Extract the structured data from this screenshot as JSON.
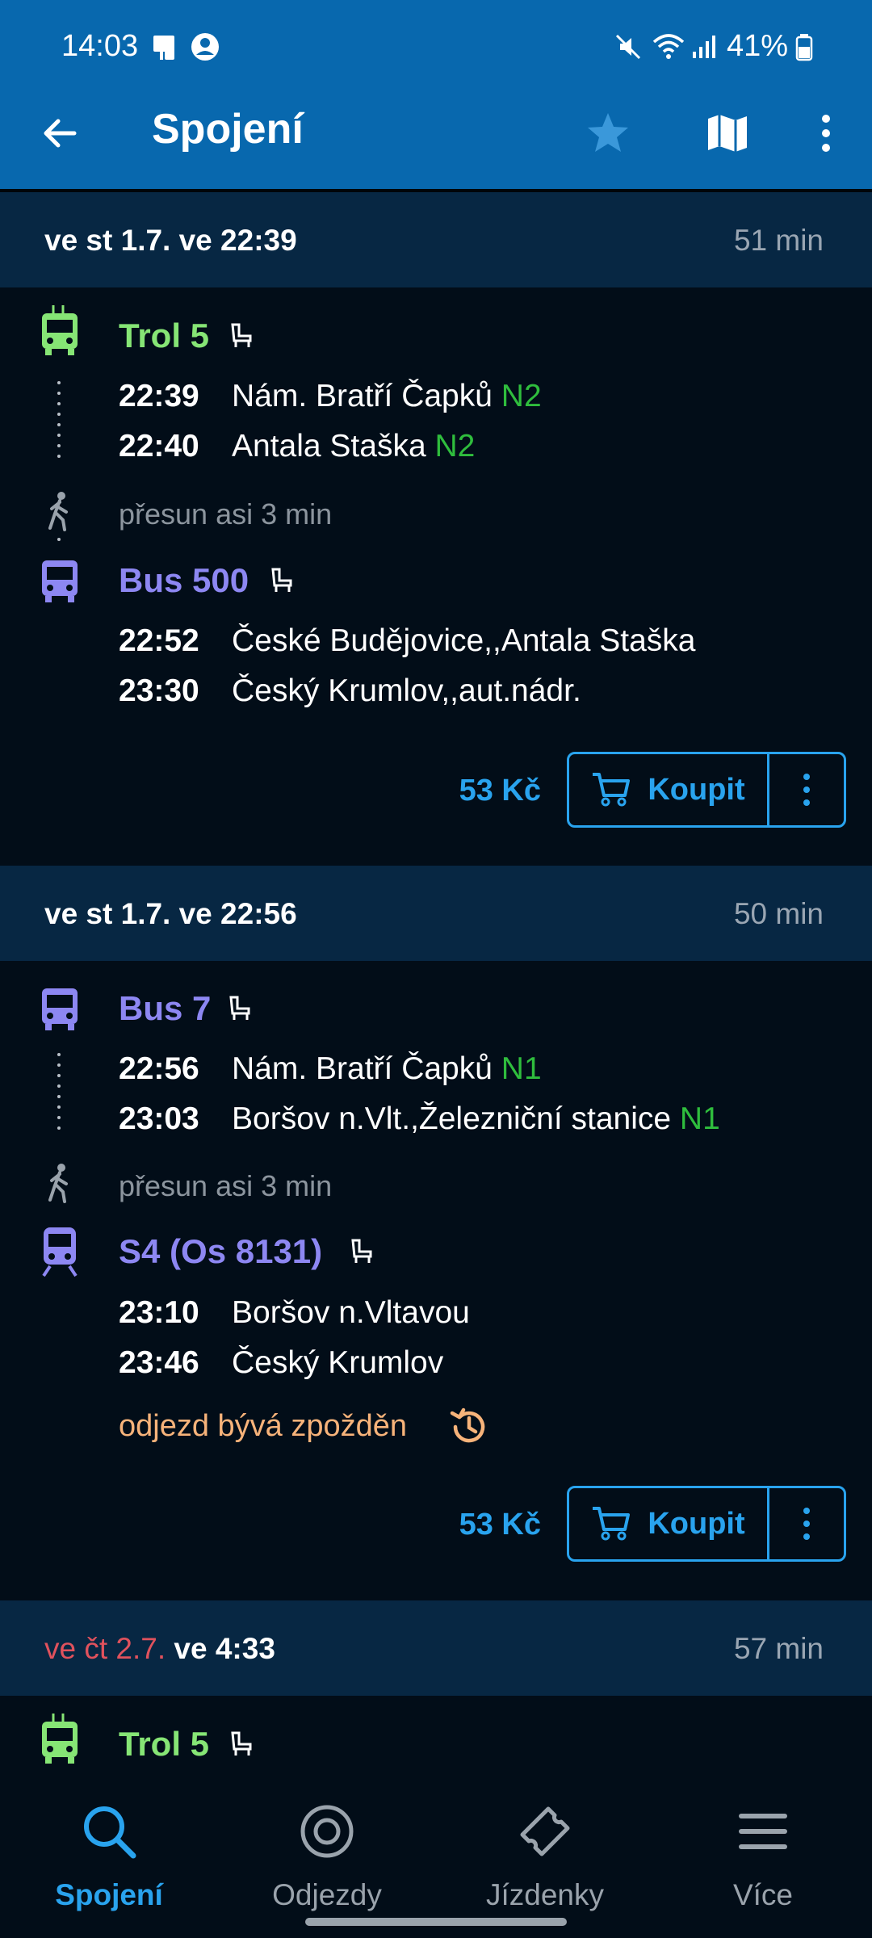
{
  "status_bar": {
    "time": "14:03",
    "battery": "41%"
  },
  "appbar": {
    "title": "Spojení"
  },
  "colors": {
    "header": "#0868ae",
    "section": "#072743",
    "accent": "#29a3ee",
    "trolley": "#86e575",
    "bus": "#8d87f2",
    "platform": "#2fbd3d",
    "delay": "#f7b37a"
  },
  "connections": [
    {
      "date": "ve st 1.7. ve 22:39",
      "duration": "51 min",
      "legs": [
        {
          "icon": "trolleybus-icon",
          "line": "Trol 5",
          "stops": [
            {
              "time": "22:39",
              "name": "Nám. Bratří Čapků",
              "platform": "N2"
            },
            {
              "time": "22:40",
              "name": "Antala Staška",
              "platform": "N2"
            }
          ]
        },
        {
          "icon": "bus-icon",
          "line": "Bus 500",
          "stops": [
            {
              "time": "22:52",
              "name": "České Budějovice,,Antala Staška"
            },
            {
              "time": "23:30",
              "name": "Český Krumlov,,aut.nádr."
            }
          ]
        }
      ],
      "transfer": "přesun asi 3 min",
      "price": "53 Kč",
      "buy_label": "Koupit"
    },
    {
      "date": "ve st 1.7. ve 22:56",
      "duration": "50 min",
      "legs": [
        {
          "icon": "bus-icon",
          "line": "Bus 7",
          "stops": [
            {
              "time": "22:56",
              "name": "Nám. Bratří Čapků",
              "platform": "N1"
            },
            {
              "time": "23:03",
              "name": "Boršov n.Vlt.,Železniční stanice",
              "platform": "N1"
            }
          ]
        },
        {
          "icon": "train-icon",
          "line": "S4 (Os 8131)",
          "stops": [
            {
              "time": "23:10",
              "name": "Boršov n.Vltavou"
            },
            {
              "time": "23:46",
              "name": "Český Krumlov"
            }
          ]
        }
      ],
      "transfer": "přesun asi 3 min",
      "delay_note": "odjezd bývá zpožděn",
      "price": "53 Kč",
      "buy_label": "Koupit"
    },
    {
      "date_red": "ve čt 2.7.",
      "date_rest": " ve 4:33",
      "duration": "57 min",
      "legs": [
        {
          "icon": "trolleybus-icon",
          "line": "Trol 5"
        }
      ]
    }
  ],
  "bottom_nav": [
    {
      "label": "Spojení",
      "icon": "search-icon",
      "active": true
    },
    {
      "label": "Odjezdy",
      "icon": "target-icon"
    },
    {
      "label": "Jízdenky",
      "icon": "ticket-icon"
    },
    {
      "label": "Více",
      "icon": "menu-icon"
    }
  ]
}
